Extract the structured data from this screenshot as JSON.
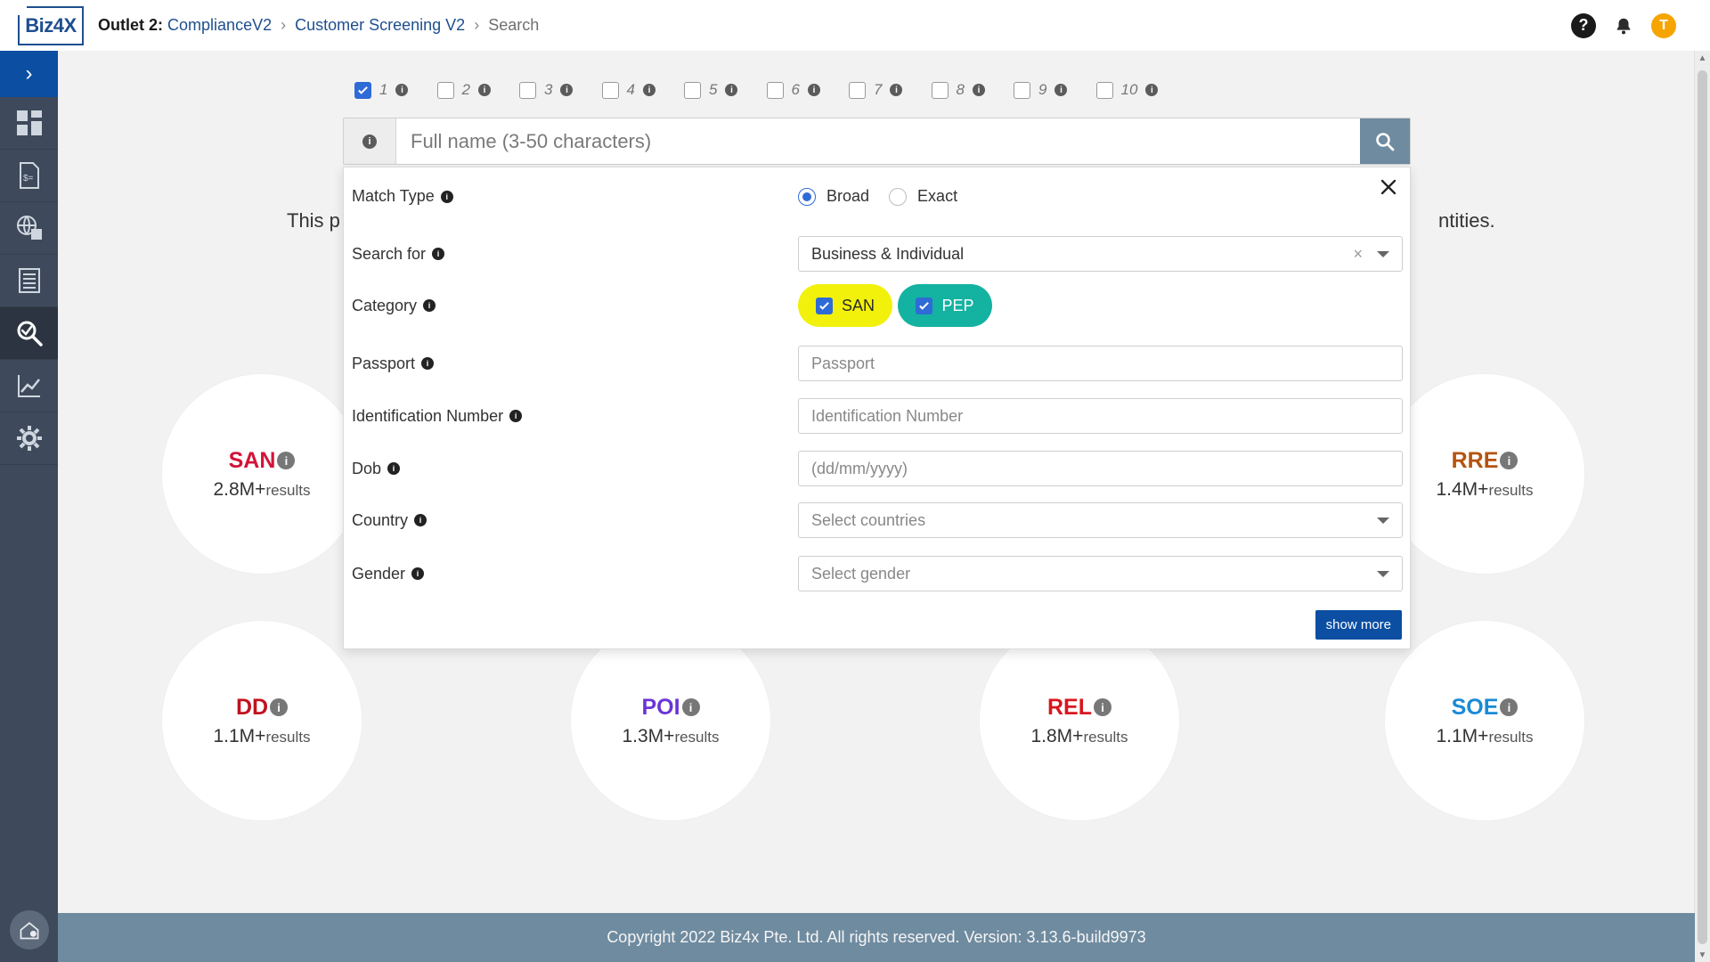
{
  "topbar": {
    "logo_text": "Biz4X",
    "breadcrumb": {
      "outlet": "Outlet 2:",
      "outlet_value": "ComplianceV2",
      "module": "Customer Screening V2",
      "current": "Search"
    },
    "help_icon": "question-circle",
    "notifications_icon": "bell",
    "avatar_initial": "T",
    "avatar_color": "#f6a400"
  },
  "sidebar": {
    "toggle_icon": "chevron-right",
    "items": [
      {
        "name": "dashboard",
        "icon": "grid"
      },
      {
        "name": "invoice",
        "icon": "document-dollar"
      },
      {
        "name": "global",
        "icon": "globe-building"
      },
      {
        "name": "accounting",
        "icon": "ledger"
      },
      {
        "name": "screening",
        "icon": "magnifier-check",
        "active": true
      },
      {
        "name": "analytics",
        "icon": "chart-line"
      },
      {
        "name": "settings",
        "icon": "gear"
      }
    ],
    "bottom_icon": "home-settings",
    "bg_color": "#3e4a5b",
    "accent_color": "#0b4ea2"
  },
  "search": {
    "slots": [
      {
        "label": "1",
        "checked": true
      },
      {
        "label": "2",
        "checked": false
      },
      {
        "label": "3",
        "checked": false
      },
      {
        "label": "4",
        "checked": false
      },
      {
        "label": "5",
        "checked": false
      },
      {
        "label": "6",
        "checked": false
      },
      {
        "label": "7",
        "checked": false
      },
      {
        "label": "8",
        "checked": false
      },
      {
        "label": "9",
        "checked": false
      },
      {
        "label": "10",
        "checked": false
      }
    ],
    "placeholder": "Full name (3-50 characters)",
    "value": "",
    "button_icon": "search"
  },
  "description": {
    "start": "This p",
    "end": "ntities."
  },
  "categories": [
    {
      "code": "SAN",
      "count": "2.8M+",
      "suffix": "results",
      "color": "#d2143a"
    },
    {
      "code": "RRE",
      "count": "1.4M+",
      "suffix": "results",
      "color": "#b5530e"
    },
    {
      "code": "DD",
      "count": "1.1M+",
      "suffix": "results",
      "color": "#c0121f"
    },
    {
      "code": "POI",
      "count": "1.3M+",
      "suffix": "results",
      "color": "#6a35d6"
    },
    {
      "code": "REL",
      "count": "1.8M+",
      "suffix": "results",
      "color": "#d9161e"
    },
    {
      "code": "SOE",
      "count": "1.1M+",
      "suffix": "results",
      "color": "#1a8ad6"
    }
  ],
  "panel": {
    "close_icon": "close",
    "match_type": {
      "label": "Match Type",
      "options": [
        "Broad",
        "Exact"
      ],
      "selected": "Broad"
    },
    "search_for": {
      "label": "Search for",
      "value": "Business & Individual"
    },
    "category": {
      "label": "Category",
      "chips": [
        {
          "label": "SAN",
          "checked": true,
          "color": "#f2f10c"
        },
        {
          "label": "PEP",
          "checked": true,
          "color": "#14b2a1"
        }
      ]
    },
    "passport": {
      "label": "Passport",
      "placeholder": "Passport"
    },
    "identification": {
      "label": "Identification Number",
      "placeholder": "Identification Number"
    },
    "dob": {
      "label": "Dob",
      "placeholder": "(dd/mm/yyyy)"
    },
    "country": {
      "label": "Country",
      "placeholder": "Select countries"
    },
    "gender": {
      "label": "Gender",
      "placeholder": "Select gender"
    },
    "show_more": "show more"
  },
  "footer": {
    "text": "Copyright 2022 Biz4x Pte. Ltd. All rights reserved. Version: 3.13.6-build9973",
    "bg_color": "#6f8ba0"
  }
}
